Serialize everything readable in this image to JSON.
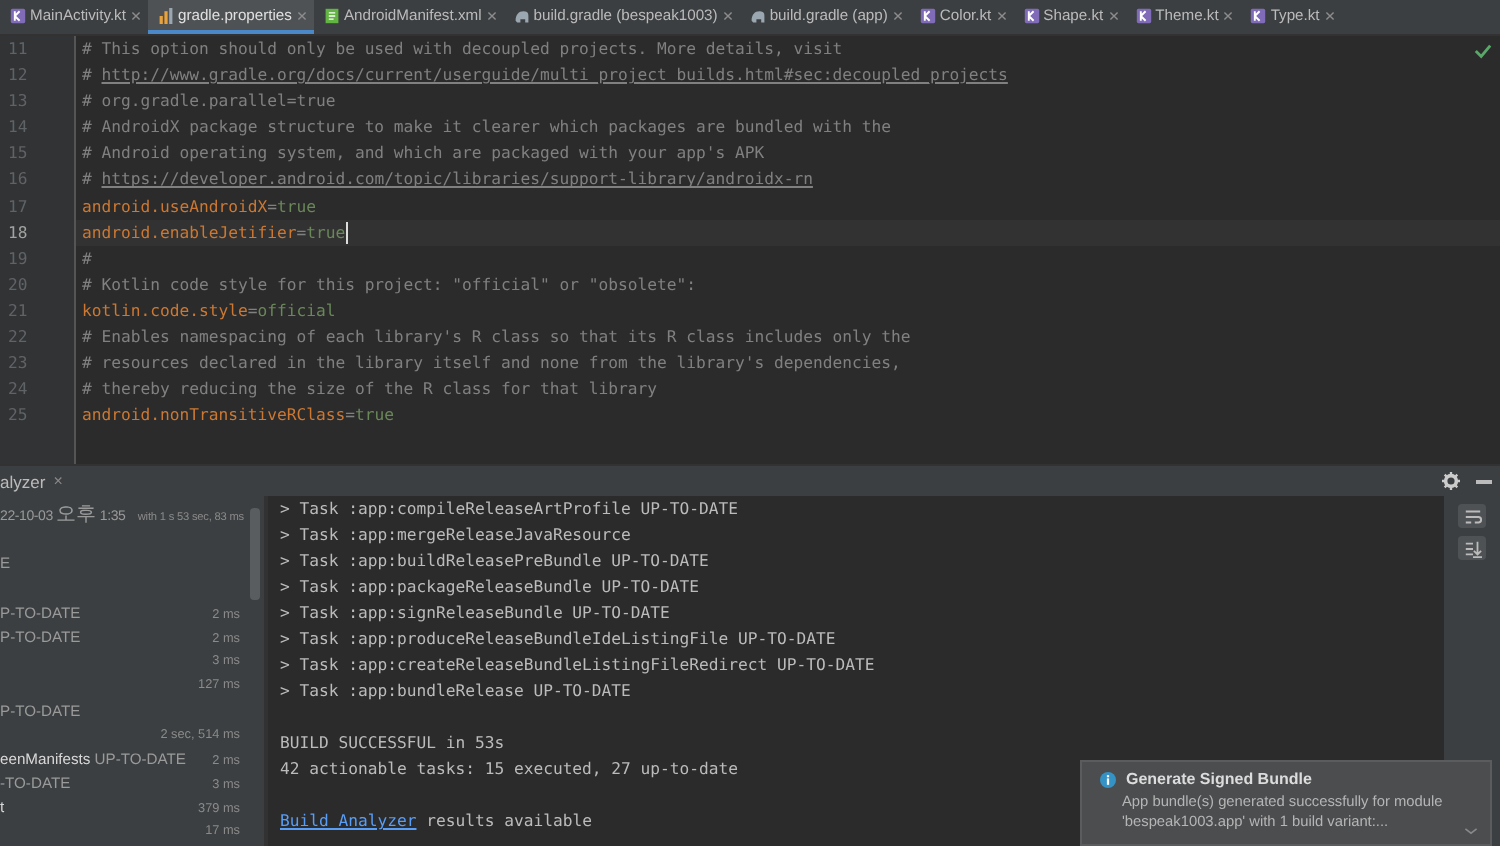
{
  "tabs": [
    {
      "label": "MainActivity.kt",
      "kind": "kotlin",
      "selected": false
    },
    {
      "label": "gradle.properties",
      "kind": "properties",
      "selected": true
    },
    {
      "label": "AndroidManifest.xml",
      "kind": "manifest",
      "selected": false
    },
    {
      "label": "build.gradle (bespeak1003)",
      "kind": "gradle",
      "selected": false
    },
    {
      "label": "build.gradle (app)",
      "kind": "gradle",
      "selected": false
    },
    {
      "label": "Color.kt",
      "kind": "kotlin",
      "selected": false
    },
    {
      "label": "Shape.kt",
      "kind": "kotlin",
      "selected": false
    },
    {
      "label": "Theme.kt",
      "kind": "kotlin",
      "selected": false
    },
    {
      "label": "Type.kt",
      "kind": "kotlin",
      "selected": false
    }
  ],
  "editor": {
    "lines": [
      {
        "number": "11",
        "current": false,
        "segments": [
          {
            "kind": "comment",
            "text": "# This option should only be used with decoupled projects. More details, visit"
          }
        ]
      },
      {
        "number": "12",
        "current": false,
        "segments": [
          {
            "kind": "comment",
            "text": "# "
          },
          {
            "kind": "link",
            "text": "http://www.gradle.org/docs/current/userguide/multi_project_builds.html#sec:decoupled_projects"
          }
        ]
      },
      {
        "number": "13",
        "current": false,
        "segments": [
          {
            "kind": "comment",
            "text": "# org.gradle.parallel=true"
          }
        ]
      },
      {
        "number": "14",
        "current": false,
        "segments": [
          {
            "kind": "comment",
            "text": "# AndroidX package structure to make it clearer which packages are bundled with the"
          }
        ]
      },
      {
        "number": "15",
        "current": false,
        "segments": [
          {
            "kind": "comment",
            "text": "# Android operating system, and which are packaged with your app's APK"
          }
        ]
      },
      {
        "number": "16",
        "current": false,
        "segments": [
          {
            "kind": "comment",
            "text": "# "
          },
          {
            "kind": "link",
            "text": "https://developer.android.com/topic/libraries/support-library/androidx-rn"
          }
        ]
      },
      {
        "number": "17",
        "current": false,
        "segments": [
          {
            "kind": "key",
            "text": "android.useAndroidX"
          },
          {
            "kind": "sign",
            "text": "="
          },
          {
            "kind": "value",
            "text": "true"
          }
        ]
      },
      {
        "number": "18",
        "current": true,
        "segments": [
          {
            "kind": "key",
            "text": "android.enableJetifier"
          },
          {
            "kind": "sign",
            "text": "="
          },
          {
            "kind": "value",
            "text": "true"
          }
        ]
      },
      {
        "number": "19",
        "current": false,
        "segments": [
          {
            "kind": "comment",
            "text": "#"
          }
        ]
      },
      {
        "number": "20",
        "current": false,
        "segments": [
          {
            "kind": "comment",
            "text": "# Kotlin code style for this project: \"official\" or \"obsolete\":"
          }
        ]
      },
      {
        "number": "21",
        "current": false,
        "segments": [
          {
            "kind": "key",
            "text": "kotlin.code.style"
          },
          {
            "kind": "sign",
            "text": "="
          },
          {
            "kind": "value",
            "text": "official"
          }
        ]
      },
      {
        "number": "22",
        "current": false,
        "segments": [
          {
            "kind": "comment",
            "text": "# Enables namespacing of each library's R class so that its R class includes only the"
          }
        ]
      },
      {
        "number": "23",
        "current": false,
        "segments": [
          {
            "kind": "comment",
            "text": "# resources declared in the library itself and none from the library's dependencies,"
          }
        ]
      },
      {
        "number": "24",
        "current": false,
        "segments": [
          {
            "kind": "comment",
            "text": "# thereby reducing the size of the R class for that library"
          }
        ]
      },
      {
        "number": "25",
        "current": false,
        "segments": [
          {
            "kind": "key",
            "text": "android.nonTransitiveRClass"
          },
          {
            "kind": "sign",
            "text": "="
          },
          {
            "kind": "value",
            "text": "true"
          }
        ]
      }
    ]
  },
  "tool_window": {
    "title": "alyzer",
    "close": "×",
    "tree": [
      {
        "kind": "item",
        "label": "22-10-03 오후 1:35",
        "time": "with 1 s 53 sec, 83 ms",
        "bright": false
      },
      {
        "kind": "blank"
      },
      {
        "kind": "item",
        "label": "E",
        "bright": false
      },
      {
        "kind": "blank"
      },
      {
        "kind": "item",
        "label": "P-TO-DATE",
        "time": "2 ms",
        "bright": false
      },
      {
        "kind": "item",
        "label": "P-TO-DATE",
        "time": "2 ms",
        "bright": false
      },
      {
        "kind": "item",
        "time": "3 ms"
      },
      {
        "kind": "item",
        "time": "127 ms"
      },
      {
        "kind": "item",
        "label": "P-TO-DATE",
        "bright": false
      },
      {
        "kind": "item",
        "time": "2 sec, 514 ms"
      },
      {
        "kind": "item",
        "label": "eenManifests",
        "suffix": "UP-TO-DATE",
        "time": "2 ms",
        "bright": true
      },
      {
        "kind": "item",
        "label": "-TO-DATE",
        "time": "3 ms",
        "bright": false
      },
      {
        "kind": "item",
        "label": "t",
        "time": "379 ms",
        "bright": true
      },
      {
        "kind": "item",
        "time": "17 ms"
      }
    ],
    "console": [
      {
        "kind": "text",
        "text": "> Task :app:compileReleaseArtProfile UP-TO-DATE"
      },
      {
        "kind": "text",
        "text": "> Task :app:mergeReleaseJavaResource"
      },
      {
        "kind": "text",
        "text": "> Task :app:buildReleasePreBundle UP-TO-DATE"
      },
      {
        "kind": "text",
        "text": "> Task :app:packageReleaseBundle UP-TO-DATE"
      },
      {
        "kind": "text",
        "text": "> Task :app:signReleaseBundle UP-TO-DATE"
      },
      {
        "kind": "text",
        "text": "> Task :app:produceReleaseBundleIdeListingFile UP-TO-DATE"
      },
      {
        "kind": "text",
        "text": "> Task :app:createReleaseBundleListingFileRedirect UP-TO-DATE"
      },
      {
        "kind": "text",
        "text": "> Task :app:bundleRelease UP-TO-DATE"
      },
      {
        "kind": "blank"
      },
      {
        "kind": "text",
        "text": "BUILD SUCCESSFUL in 53s"
      },
      {
        "kind": "text",
        "text": "42 actionable tasks: 15 executed, 27 up-to-date"
      },
      {
        "kind": "blank"
      },
      {
        "kind": "link",
        "link": "Build Analyzer",
        "text": " results available"
      }
    ]
  },
  "notification": {
    "title": "Generate Signed Bundle",
    "body": [
      "App bundle(s) generated successfully for module",
      "'bespeak1003.app' with 1 build variant:..."
    ]
  }
}
